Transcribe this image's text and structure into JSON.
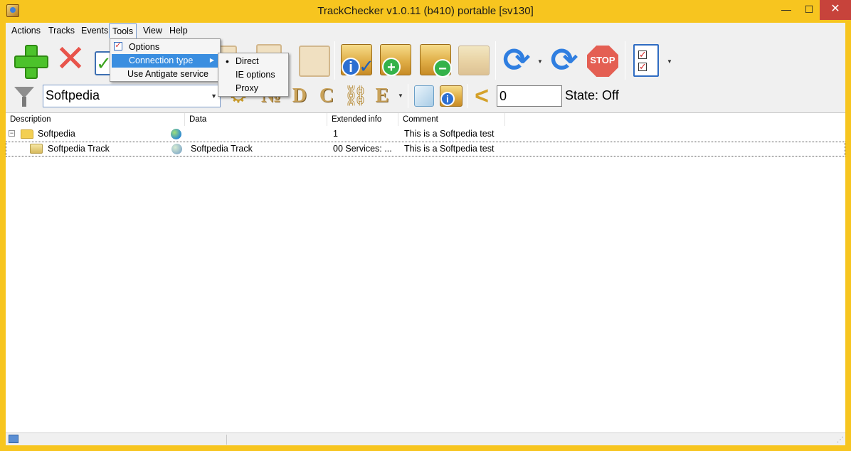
{
  "window": {
    "title": "TrackChecker v1.0.11 (b410)  portable [sv130]",
    "minimize": "—",
    "maximize": "☐",
    "close": "✕",
    "accent_color": "#f7c51f"
  },
  "menubar": {
    "items": [
      "Actions",
      "Tracks",
      "Events",
      "Tools",
      "View",
      "Help"
    ],
    "open": "Tools"
  },
  "tools_menu": {
    "items": [
      {
        "label": "Options",
        "icon": "checklist-icon"
      },
      {
        "label": "Connection type",
        "submenu": true
      },
      {
        "label": "Use Antigate service"
      }
    ],
    "highlighted": "Connection type"
  },
  "connection_submenu": {
    "items": [
      "Direct",
      "IE options",
      "Proxy"
    ],
    "selected": "Direct"
  },
  "toolbar1": {
    "buttons": [
      "add-icon",
      "delete-icon",
      "check-icon",
      "copy-icon",
      "paste-icon",
      "box-info-icon",
      "box-add-icon",
      "box-remove-icon",
      "boxes-icon",
      "refresh-icon",
      "refresh-all-icon",
      "stop-icon",
      "checklist-icon"
    ],
    "stop_label": "STOP"
  },
  "toolbar2": {
    "filter_value": "Softpedia",
    "letters": [
      "№",
      "D",
      "C",
      "E"
    ],
    "counter_value": "0",
    "state_label": "State: Off"
  },
  "grid": {
    "columns": [
      "Description",
      "Data",
      "Extended info",
      "Comment"
    ],
    "rows": [
      {
        "description": "Softpedia",
        "data": "",
        "extended": "1",
        "comment": "This is a Softpedia test",
        "type": "folder"
      },
      {
        "description": "Softpedia Track",
        "data": "Softpedia Track",
        "extended": "00 Services: ...",
        "comment": "This is a Softpedia test",
        "type": "track"
      }
    ]
  }
}
